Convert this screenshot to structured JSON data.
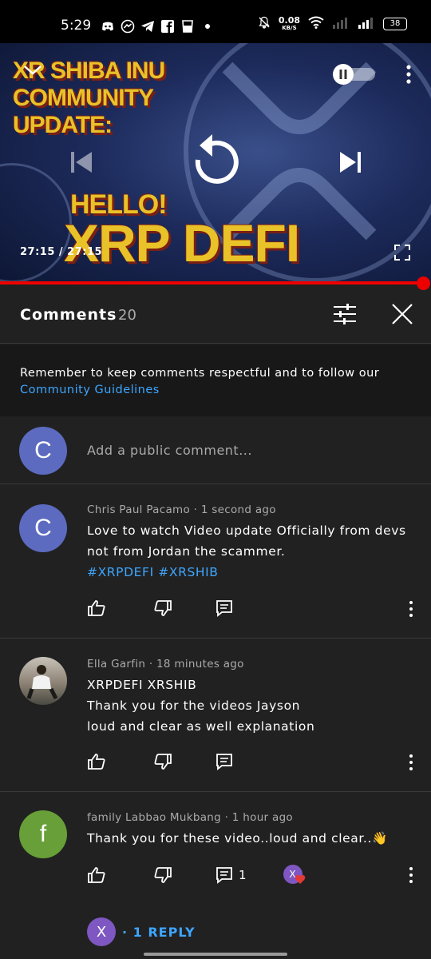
{
  "status_bar": {
    "time": "5:29",
    "speed_value": "0.08",
    "speed_unit": "KB/S",
    "battery": "38",
    "app_icons": [
      "discord-icon",
      "messenger-icon",
      "telegram-icon",
      "facebook-icon",
      "glass-icon",
      "dot-icon"
    ]
  },
  "video": {
    "title_line1": "XR SHIBA INU",
    "title_line2": "COMMUNITY",
    "title_line3": "UPDATE:",
    "subtitle_line1": "HELLO!",
    "subtitle_line2": "XRP DEFI",
    "time_display": "27:15 / 27:15",
    "progress_fraction": 1.0
  },
  "comments_panel": {
    "title": "Comments",
    "count": "20",
    "notice_text": "Remember to keep comments respectful and to follow our",
    "notice_link": "Community Guidelines",
    "add_placeholder": "Add a public comment...",
    "current_user_initial": "C",
    "current_user_color": "#5c6bc0"
  },
  "comments": [
    {
      "initial": "C",
      "avatar_color": "#5c6bc0",
      "author": "Chris Paul Pacamo",
      "time": "1 second ago",
      "lines": [
        "Love to watch Video update Officially from devs",
        "not from Jordan the scammer."
      ],
      "hashtags": "#XRPDEFI #XRSHIB",
      "reply_count": ""
    },
    {
      "initial": "",
      "avatar_color": "#8a8f8a",
      "author": "Ella Garfin",
      "time": "18 minutes ago",
      "lines": [
        "XRPDEFI XRSHIB",
        "Thank you for the videos Jayson",
        "loud and clear as well explanation"
      ],
      "hashtags": "",
      "reply_count": ""
    },
    {
      "initial": "f",
      "avatar_color": "#689f38",
      "author": "family Labbao Mukbang",
      "time": "1 hour ago",
      "lines": [
        "Thank you for these video..loud and clear..👋"
      ],
      "hashtags": "",
      "reply_count": "1",
      "creator_heart_initial": "X"
    }
  ],
  "reply_link": {
    "initial": "X",
    "label": "· 1 REPLY"
  }
}
